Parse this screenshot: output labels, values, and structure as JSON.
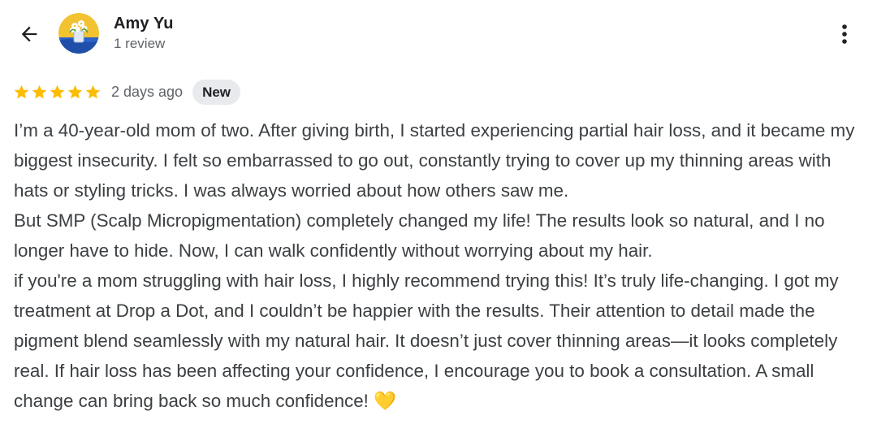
{
  "header": {
    "back_icon": "arrow-back-icon",
    "more_icon": "more-vert-icon",
    "reviewer_name": "Amy Yu",
    "review_count": "1 review"
  },
  "review": {
    "rating": 5,
    "max_rating": 5,
    "date": "2 days ago",
    "badge": "New",
    "text": "I’m a 40-year-old mom of two. After giving birth, I started experiencing partial hair loss, and it became my biggest insecurity. I felt so embarrassed to go out, constantly trying to cover up my thinning areas with hats or styling tricks. I was always worried about how others saw me.\nBut SMP (Scalp Micropigmentation) completely changed my life! The results look so natural, and I no longer have to hide. Now, I can walk confidently without worrying about my hair.\nif you're a mom struggling with hair loss, I highly recommend trying this! It’s truly life-changing. I got my treatment at Drop a Dot, and I couldn’t be happier with the results. Their attention to detail made the pigment blend seamlessly with my natural hair. It doesn’t just cover thinning areas—it looks completely real. If hair loss has been affecting your confidence, I encourage you to book a consultation. A small change can bring back so much confidence! 💛"
  },
  "colors": {
    "star": "#fbbc04",
    "badge_bg": "#e8eaed",
    "secondary_text": "#5f6368"
  }
}
